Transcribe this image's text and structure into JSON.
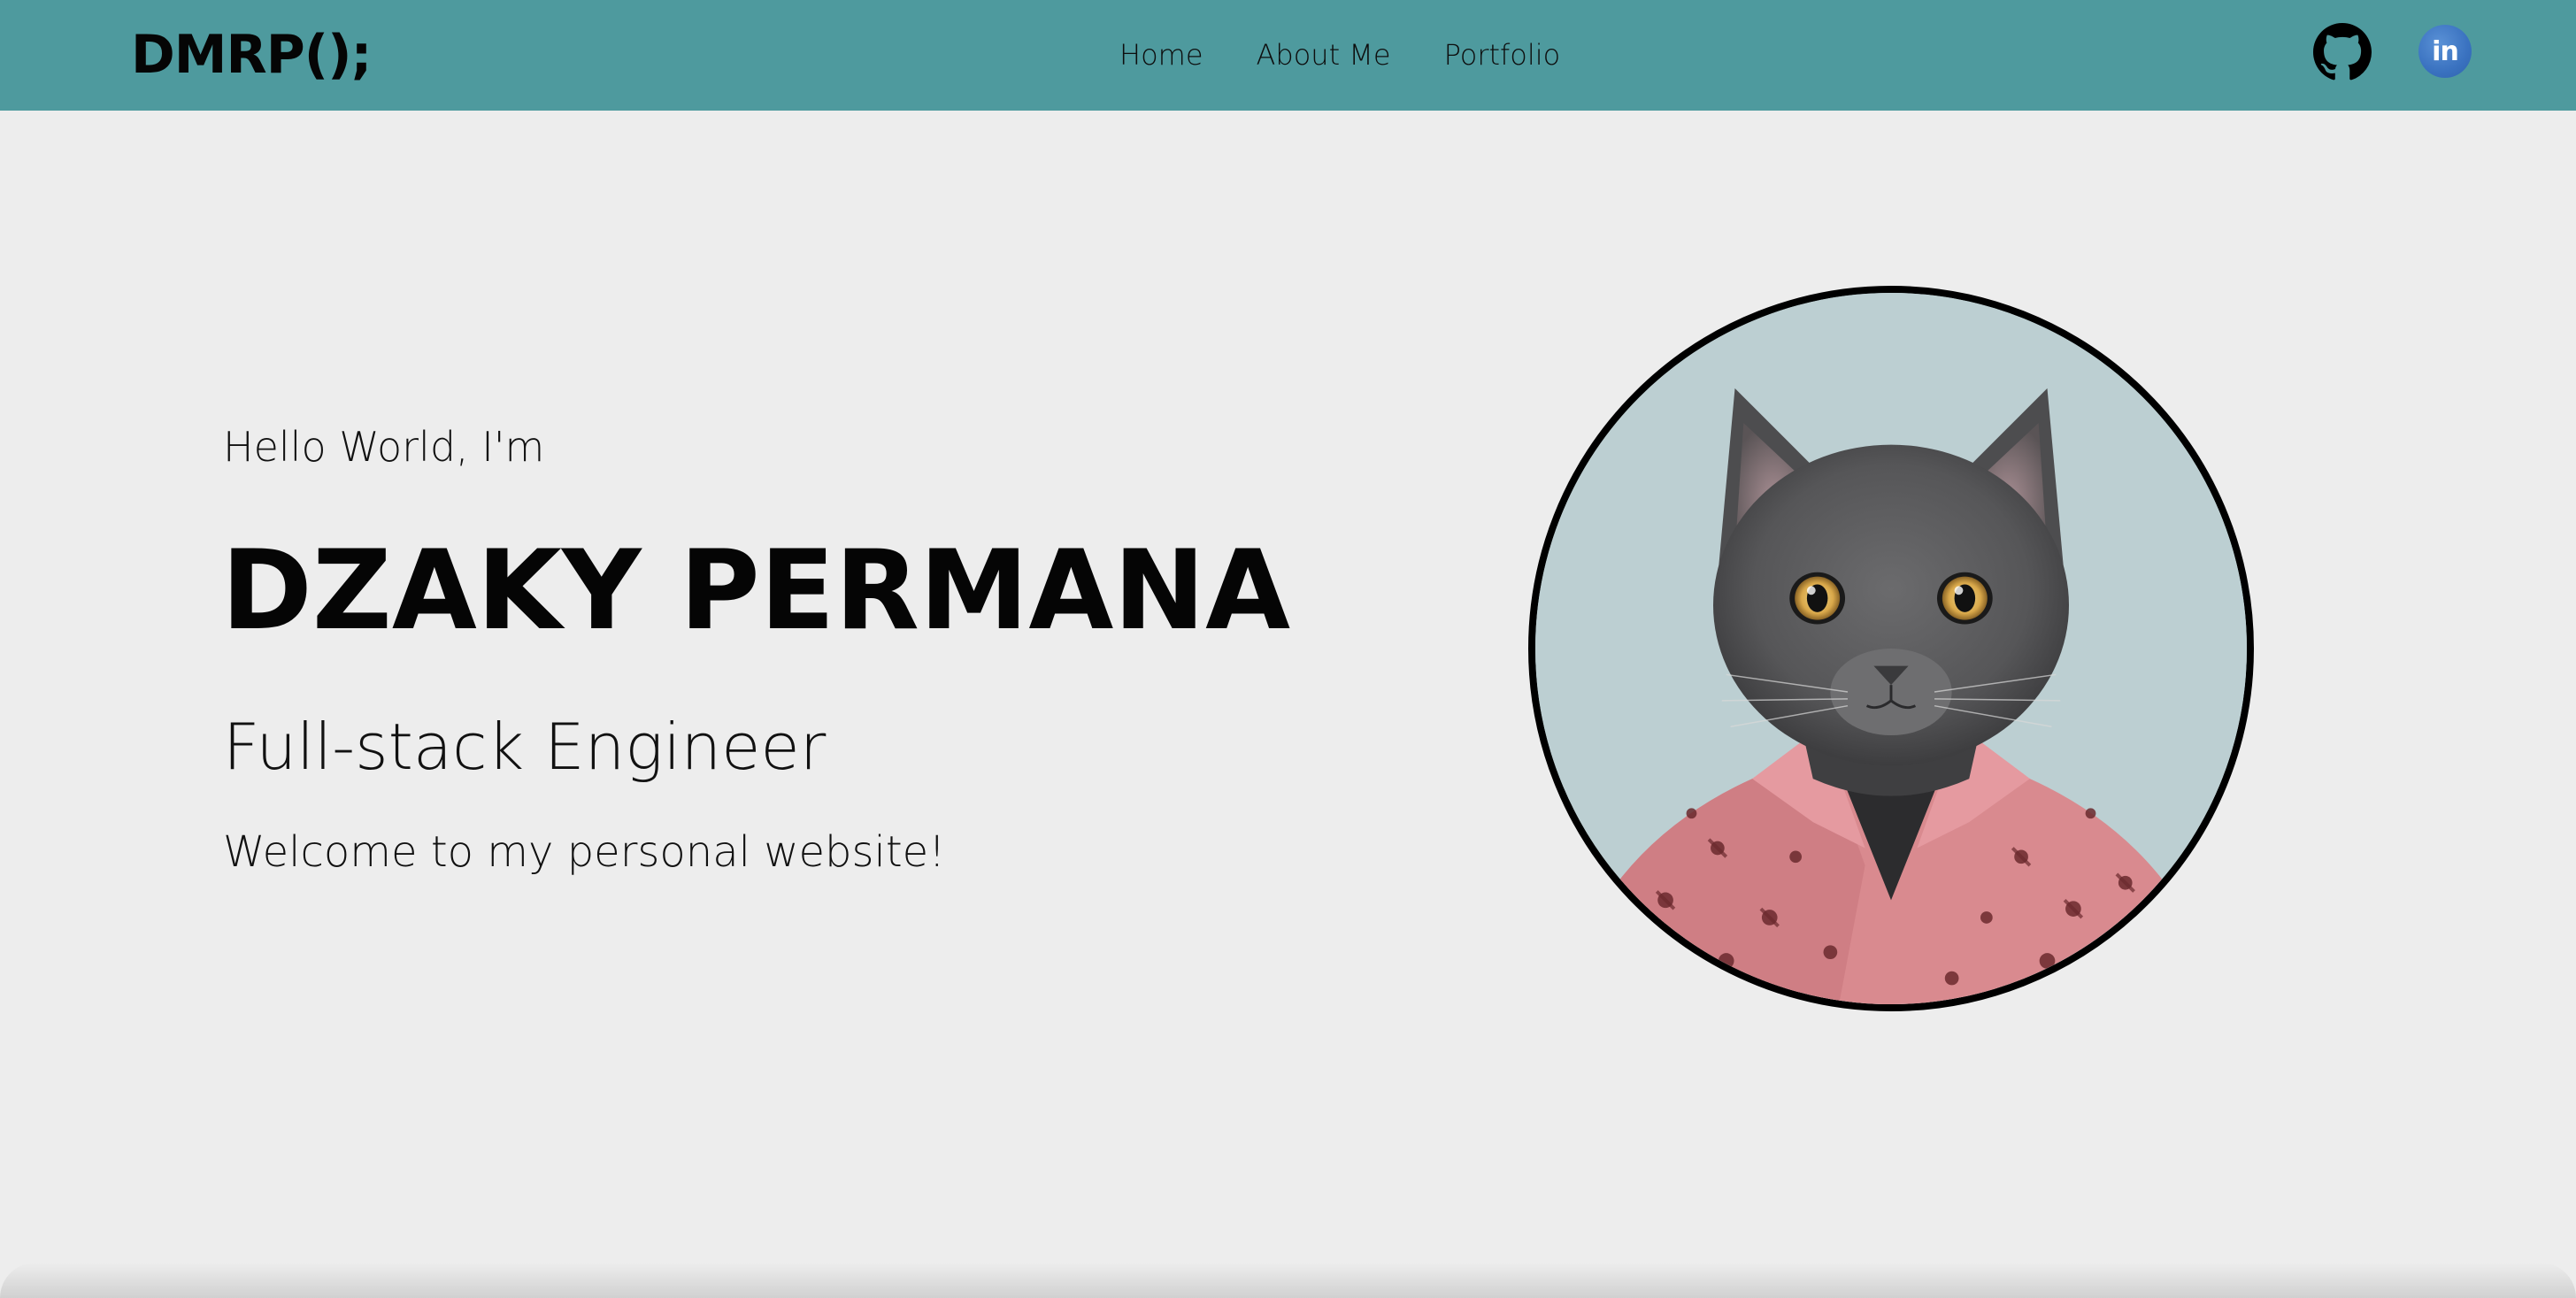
{
  "navbar": {
    "brand": "DMRP();",
    "links": [
      {
        "label": "Home"
      },
      {
        "label": "About Me"
      },
      {
        "label": "Portfolio"
      }
    ],
    "social": [
      {
        "icon": "github-icon"
      },
      {
        "icon": "linkedin-icon",
        "glyph": "in"
      }
    ],
    "background_color": "#4e9a9e"
  },
  "hero": {
    "greeting": "Hello World, I'm",
    "name": "DZAKY PERMANA",
    "role": "Full-stack Engineer",
    "welcome": "Welcome to my personal website!"
  },
  "avatar": {
    "subject": "gray cat wearing pink palm-print shirt",
    "background_color": "#bccfd2",
    "border_color": "#000000"
  },
  "page": {
    "background_color": "#ededed"
  }
}
